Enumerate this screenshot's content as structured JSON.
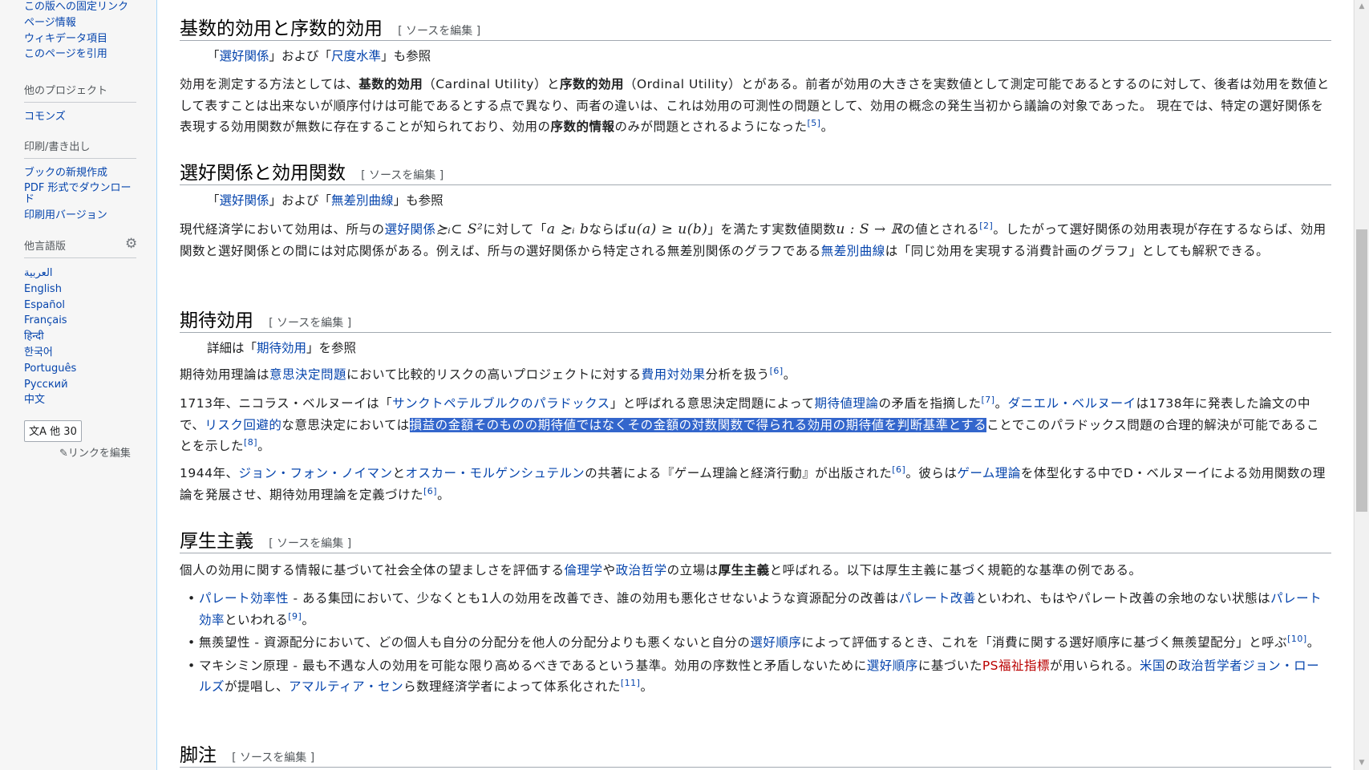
{
  "sidebar": {
    "tools_links": [
      "この版への固定リンク",
      "ページ情報",
      "ウィキデータ項目",
      "このページを引用"
    ],
    "other_projects": {
      "heading": "他のプロジェクト",
      "links": [
        "コモンズ"
      ]
    },
    "print_export": {
      "heading": "印刷/書き出し",
      "links": [
        "ブックの新規作成",
        "PDF 形式でダウンロード",
        "印刷用バージョン"
      ]
    },
    "languages": {
      "heading": "他言語版",
      "links": [
        "العربية",
        "English",
        "Español",
        "Français",
        "हिन्दी",
        "한국어",
        "Português",
        "Русский",
        "中文"
      ],
      "more_button": "文A 他 30",
      "edit_links": "✎リンクを編集"
    }
  },
  "edit_source": "[ ソースを編集 ]",
  "sec1": {
    "title": "基数的効用と序数的効用",
    "hat": [
      "「",
      "選好関係",
      "」および「",
      "尺度水準",
      "」も参照"
    ],
    "p1": {
      "t1": "効用を測定する方法としては、",
      "b1": "基数的効用",
      "t2": "（Cardinal Utility）と",
      "b2": "序数的効用",
      "t3": "（Ordinal Utility）とがある。前者が効用の大きさを実数値として測定可能であるとするのに対して、後者は効用を数値として表すことは出来ないが順序付けは可能であるとする点で異なり、両者の違いは、これは効用の可測性の問題として、効用の概念の発生当初から議論の対象であった。 現在では、特定の選好関係を表現する効用関数が無数に存在することが知られており、効用の",
      "b3": "序数的情報",
      "t4": "のみが問題とされるようになった",
      "ref": "[5]",
      "t5": "。"
    }
  },
  "sec2": {
    "title": "選好関係と効用関数",
    "hat": [
      "「",
      "選好関係",
      "」および「",
      "無差別曲線",
      "」も参照"
    ],
    "p1": {
      "t1": "現代経済学において効用は、所与の",
      "l1": "選好関係",
      "m1": "≿ᵢ⊂ S²",
      "t2": "に対して「",
      "m2": "a ≿ᵢ b",
      "t3": "ならば",
      "m3": "u(a) ≥ u(b)",
      "t4": "」を満たす実数値関数",
      "m4": "u : S → ℝ",
      "t5": "の値とされる",
      "ref": "[2]",
      "t6": "。したがって選好関係の効用表現が存在するならば、効用関数と選好関係との間には対応関係がある。例えば、所与の選好関係から特定される無差別関係のグラフである",
      "l2": "無差別曲線",
      "t7": "は「同じ効用を実現する消費計画のグラフ」としても解釈できる。"
    }
  },
  "sec3": {
    "title": "期待効用",
    "hat": [
      "詳細は「",
      "期待効用",
      "」を参照"
    ],
    "p1": {
      "t1": "期待効用理論は",
      "l1": "意思決定問題",
      "t2": "において比較的リスクの高いプロジェクトに対する",
      "l2": "費用対効果",
      "t3": "分析を扱う",
      "ref": "[6]",
      "t4": "。"
    },
    "p2": {
      "t1": "1713年、ニコラス・ベルヌーイは「",
      "l1": "サンクトペテルブルクのパラドックス",
      "t2": "」と呼ばれる意思決定問題によって",
      "l2": "期待値理論",
      "t3": "の矛盾を指摘した",
      "ref1": "[7]",
      "t4": "。",
      "l3": "ダニエル・ベルヌーイ",
      "t5": "は1738年に発表した論文の中で、",
      "l4": "リスク回避的",
      "t6": "な意思決定においては",
      "hl": "損益の金額そのものの期待値ではなくその金額の対数関数で得られる効用の期待値を判断基準とする",
      "t7": "ことでこのパラドックス問題の合理的解決が可能であることを示した",
      "ref2": "[8]",
      "t8": "。"
    },
    "p3": {
      "t1": "1944年、",
      "l1": "ジョン・フォン・ノイマン",
      "t2": "と",
      "l2": "オスカー・モルゲンシュテルン",
      "t3": "の共著による『ゲーム理論と経済行動』が出版された",
      "ref1": "[6]",
      "t4": "。彼らは",
      "l3": "ゲーム理論",
      "t5": "を体型化する中でD・ベルヌーイによる効用関数の理論を発展させ、期待効用理論を定義づけた",
      "ref2": "[6]",
      "t6": "。"
    }
  },
  "sec4": {
    "title": "厚生主義",
    "p1": {
      "t1": "個人の効用に関する情報に基づいて社会全体の望ましさを評価する",
      "l1": "倫理学",
      "t2": "や",
      "l2": "政治哲学",
      "t3": "の立場は",
      "b1": "厚生主義",
      "t4": "と呼ばれる。以下は厚生主義に基づく規範的な基準の例である。"
    },
    "li1": {
      "l1": "パレート効率性",
      "t1": " - ある集団において、少なくとも1人の効用を改善でき、誰の効用も悪化させないような資源配分の改善は",
      "l2": "パレート改善",
      "t2": "といわれ、もはやパレート改善の余地のない状態は",
      "l3": "パレート効率",
      "t3": "といわれる",
      "ref": "[9]",
      "t4": "。"
    },
    "li2": {
      "t1": "無羨望性 - 資源配分において、どの個人も自分の分配分を他人の分配分よりも悪くないと自分の",
      "l1": "選好順序",
      "t2": "によって評価するとき、これを「消費に関する選好順序に基づく無羨望配分」と呼ぶ",
      "ref": "[10]",
      "t3": "。"
    },
    "li3": {
      "t1": "マキシミン原理 - 最も不遇な人の効用を可能な限り高めるべきであるという基準。効用の序数性と矛盾しないために",
      "l1": "選好順序",
      "t2": "に基づいた",
      "l2": "PS福祉指標",
      "t3": "が用いられる。",
      "l3": "米国",
      "t4": "の",
      "l4": "政治哲学者",
      "l5": "ジョン・ロールズ",
      "t5": "が提唱し、",
      "l6": "アマルティア・セン",
      "t6": "ら数理経済学者によって体系化された",
      "ref": "[11]",
      "t7": "。"
    }
  },
  "sec5": {
    "title": "脚注"
  }
}
